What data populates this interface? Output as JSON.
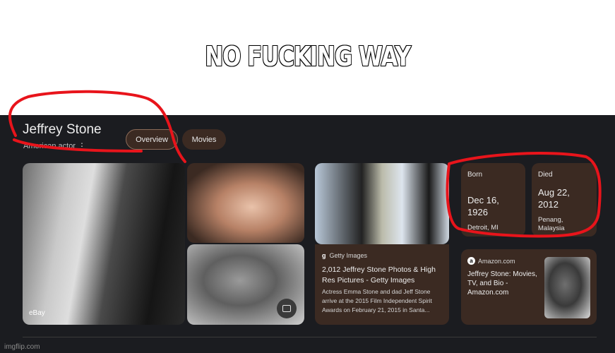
{
  "meme_caption": "NO FUCKING WAY",
  "knowledge_panel": {
    "title": "Jeffrey Stone",
    "subtitle": "American actor",
    "tabs": [
      "Overview",
      "Movies"
    ]
  },
  "images": {
    "main_source": "eBay"
  },
  "getty_card": {
    "source": "Getty Images",
    "title": "2,012 Jeffrey Stone Photos & High Res Pictures - Getty Images",
    "description": "Actress Emma Stone and dad Jeff Stone arrive at the 2015 Film Independent Spirit Awards on February 21, 2015 in Santa..."
  },
  "born_card": {
    "label": "Born",
    "date": "Dec 16, 1926",
    "place": "Detroit, MI"
  },
  "died_card": {
    "label": "Died",
    "date": "Aug 22, 2012",
    "place": "Penang, Malaysia"
  },
  "amazon_card": {
    "source": "Amazon.com",
    "title": "Jeffrey Stone: Movies, TV, and Bio - Amazon.com"
  },
  "watermark": "imgflip.com",
  "colors": {
    "panel_bg": "#1b1c20",
    "card_bg": "#3b2a22",
    "annotation_red": "#e8141b"
  },
  "icons": [
    "more-vert-icon",
    "image-search-icon",
    "getty-logo-icon",
    "amazon-logo-icon"
  ]
}
